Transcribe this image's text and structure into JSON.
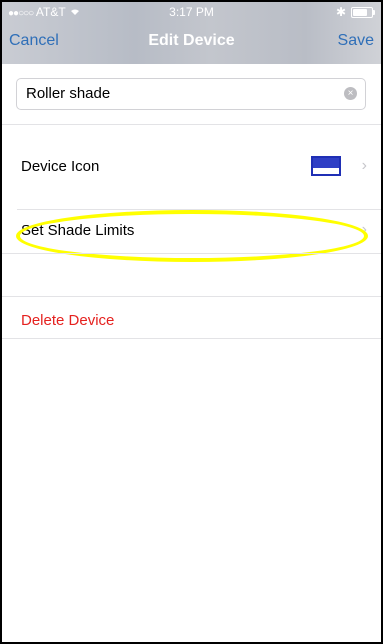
{
  "status_bar": {
    "signal": "●●○○○",
    "carrier": "AT&T",
    "wifi": "wifi-icon",
    "time": "3:17 PM",
    "bluetooth": "✱",
    "battery_level": 0.7
  },
  "nav": {
    "cancel_label": "Cancel",
    "title": "Edit Device",
    "save_label": "Save"
  },
  "name_field": {
    "value": "Roller shade"
  },
  "rows": {
    "device_icon_label": "Device Icon",
    "set_shade_limits_label": "Set Shade Limits",
    "delete_label": "Delete Device"
  },
  "colors": {
    "accent": "#2f6fb8",
    "delete": "#e5211f",
    "highlight": "#ffff00",
    "device_icon": "#2f3fc5"
  }
}
